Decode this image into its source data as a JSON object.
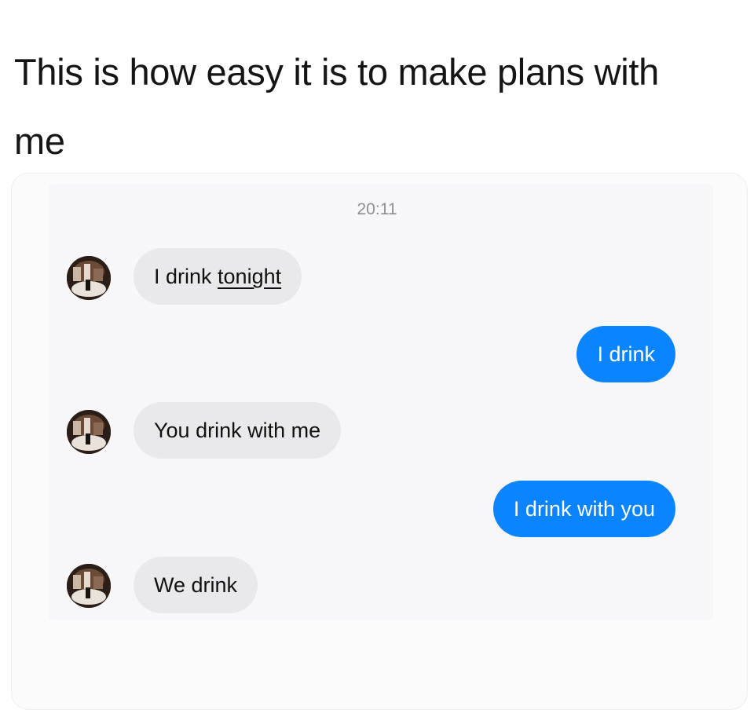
{
  "post": {
    "caption_line1": "This is how easy it is to make plans with",
    "caption_line2": "me"
  },
  "conversation": {
    "timestamp": "20:11",
    "messages": [
      {
        "sender": "contact",
        "text_plain": "I drink ",
        "text_emphasis": "tonight"
      },
      {
        "sender": "me",
        "text": "I drink"
      },
      {
        "sender": "contact",
        "text": "You drink with me"
      },
      {
        "sender": "me",
        "text": "I drink with you"
      },
      {
        "sender": "contact",
        "text": "We drink"
      }
    ]
  },
  "colors": {
    "incoming_bubble": "#e9e9eb",
    "outgoing_bubble": "#0b84ff",
    "timestamp": "#8e8e93"
  },
  "icons": {
    "contact_avatar": "profile-photo-icon"
  }
}
